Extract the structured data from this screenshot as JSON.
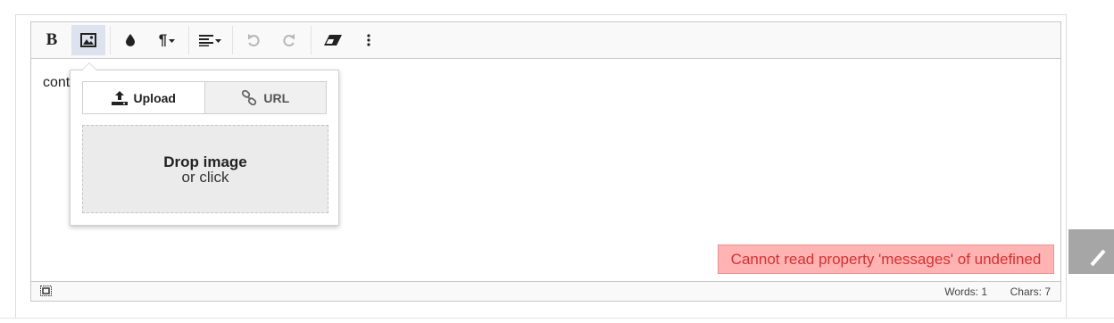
{
  "editor": {
    "content_text": "content",
    "toolbar": [
      {
        "name": "bold-button",
        "glyph": "B",
        "active": false
      },
      {
        "name": "image-button",
        "glyph": "image-icon",
        "active": true
      },
      {
        "name": "color-button",
        "glyph": "drop-icon",
        "active": false
      },
      {
        "name": "paragraph-button",
        "glyph": "¶",
        "active": false
      },
      {
        "name": "align-button",
        "glyph": "align-left-icon",
        "active": false
      },
      {
        "name": "undo-button",
        "glyph": "undo-icon",
        "active": false,
        "disabled": true
      },
      {
        "name": "redo-button",
        "glyph": "redo-icon",
        "active": false,
        "disabled": true
      },
      {
        "name": "eraser-button",
        "glyph": "eraser-icon",
        "active": false
      },
      {
        "name": "more-button",
        "glyph": "dots-vertical-icon",
        "active": false
      }
    ],
    "bold_glyph": "B",
    "paragraph_glyph": "¶"
  },
  "image_popup": {
    "tabs": {
      "upload_label": "Upload",
      "url_label": "URL"
    },
    "dropzone": {
      "title": "Drop image",
      "subtitle": "or click"
    }
  },
  "error": {
    "message": "Cannot read property 'messages' of undefined"
  },
  "statusbar": {
    "words": "Words: 1",
    "chars": "Chars: 7"
  },
  "colors": {
    "toolbar_bg": "#f9f9f9",
    "active_button_bg": "#dce3ee",
    "error_bg": "#ffb3b3",
    "error_text": "#d43232",
    "dropzone_bg": "#ebebeb",
    "side_button_bg": "#a6a6a6"
  }
}
